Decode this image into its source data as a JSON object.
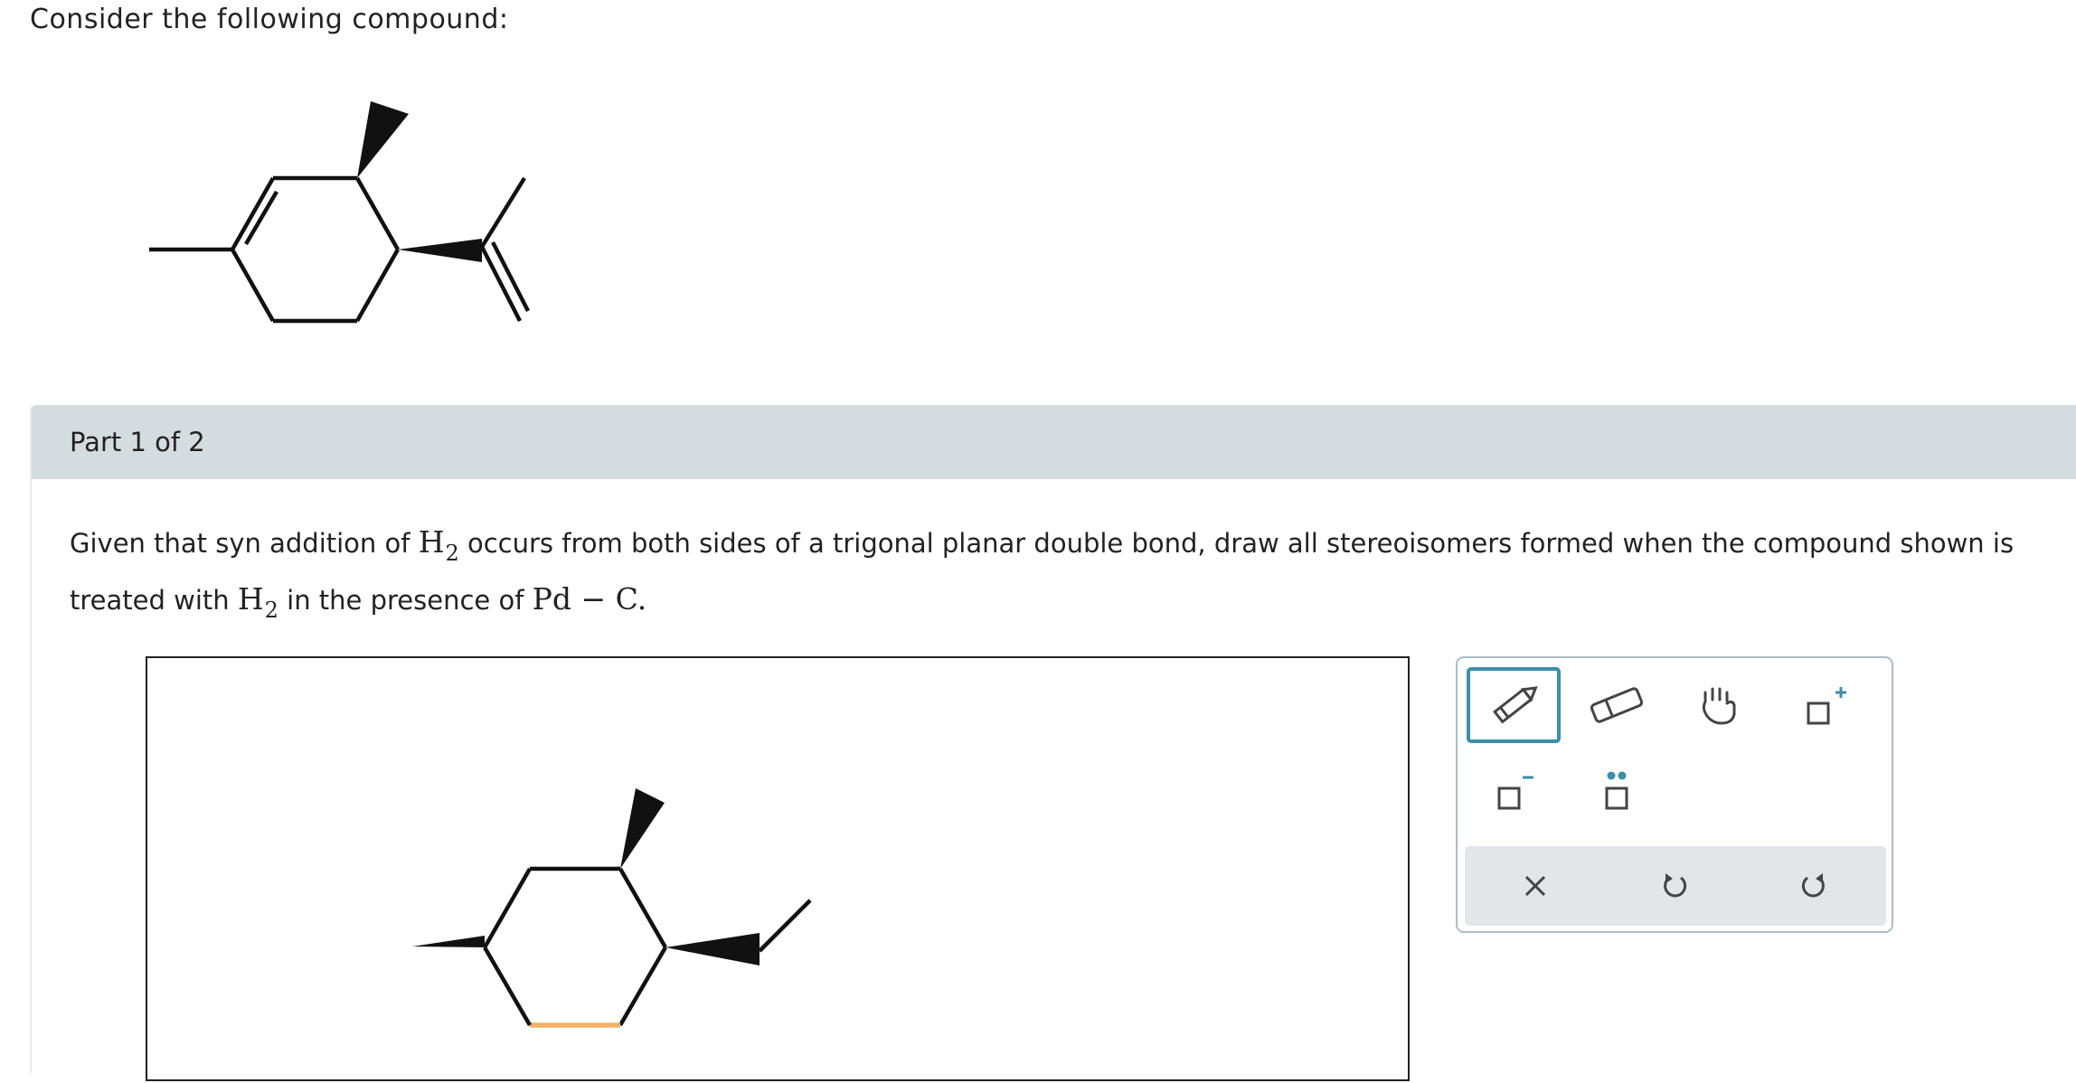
{
  "intro": {
    "text": "Consider the following compound:"
  },
  "part": {
    "title": "Part 1 of 2"
  },
  "question": {
    "seg1": "Given that syn addition of ",
    "h_symbol": "H",
    "h_sub": "2",
    "seg2": " occurs from both sides of a trigonal planar double bond, draw all stereoisomers formed when the compound shown is treated with ",
    "h2_symbol": "H",
    "h2_sub": "2",
    "seg3": " in the presence of ",
    "catalyst": "Pd",
    "dash": " − ",
    "catalyst2": "C",
    "end": "."
  },
  "toolbox": {
    "tools": [
      {
        "id": "pencil",
        "icon": "pencil-icon",
        "selected": true
      },
      {
        "id": "eraser",
        "icon": "eraser-icon",
        "selected": false
      },
      {
        "id": "hand",
        "icon": "hand-icon",
        "selected": false
      },
      {
        "id": "positive-charge",
        "icon": "positive-charge-icon",
        "selected": false
      },
      {
        "id": "negative-charge",
        "icon": "negative-charge-icon",
        "selected": false
      },
      {
        "id": "lone-pair",
        "icon": "lone-pair-icon",
        "selected": false
      }
    ],
    "actions": [
      {
        "id": "clear",
        "icon": "close-icon"
      },
      {
        "id": "undo",
        "icon": "undo-icon"
      },
      {
        "id": "redo",
        "icon": "redo-icon"
      }
    ]
  },
  "colors": {
    "accent": "#3e8ea8",
    "header_bg": "#d5dcdf",
    "highlight_bond": "#f4b068",
    "toolbox_border": "#a9bec8",
    "action_bar_bg": "#e2e6e8"
  }
}
